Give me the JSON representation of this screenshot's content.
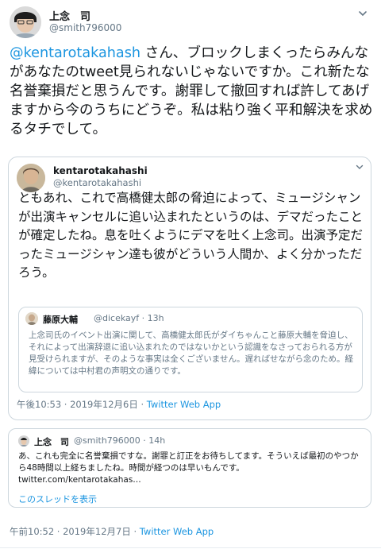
{
  "tweet": {
    "author_name": "上念　司",
    "author_handle": "@smith796000",
    "mention": "@kentarotakahash",
    "body": " さん、ブロックしまくったらみんながあなたのtweet見られないじゃないですか。これ新たな名誉棄損だと思うんです。謝罪して撤回すれば許してあげますから今のうちにどうぞ。私は粘り強く平和解決を求めるタチでして。",
    "timestamp": "午前10:52 · 2019年12月7日",
    "source": "Twitter Web App"
  },
  "quoted": {
    "author_name": "kentarotakahashi",
    "author_handle": "@kentarotakahashi",
    "body": "ともあれ、これで高橋健太郎の脅迫によって、ミュージシャンが出演キャンセルに追い込まれたというのは、デマだったことが確定したね。息を吐くようにデマを吐く上念司。出演予定だったミュージシャン達も彼がどういう人間か、よく分かっただろう。",
    "timestamp": "午後10:53 · 2019年12月6日",
    "source": "Twitter Web App",
    "inner": {
      "author_name": "藤原大輔",
      "author_meta": "@dicekayf · 13h",
      "body": "上念司氏のイベント出演に関して、高橋健太郎氏がダイちゃんこと藤原大輔を脅迫し、それによって出演辞退に追い込まれたのではないかという認識をなさっておられる方が見受けられますが、そのような事実は全くございません。遅ればせながら念のため。経緯については中村君の声明文の通りです。"
    }
  },
  "reply_quote": {
    "author_name": "上念　司",
    "author_meta": "@smith796000 · 14h",
    "body": "あ、これも完全に名誉棄損ですな。謝罪と訂正をお待ちしてます。そういえば最初のやつから48時間以上経ちましたね。時間が経つのは早いもんです。",
    "link": "twitter.com/kentarotakahas…",
    "thread_label": "このスレッドを表示"
  },
  "colors": {
    "link": "#1b95e0",
    "muted": "#657786",
    "border": "#ccd6dd",
    "text": "#14171a"
  },
  "icons": [
    "avatar",
    "chevron-down-icon"
  ]
}
